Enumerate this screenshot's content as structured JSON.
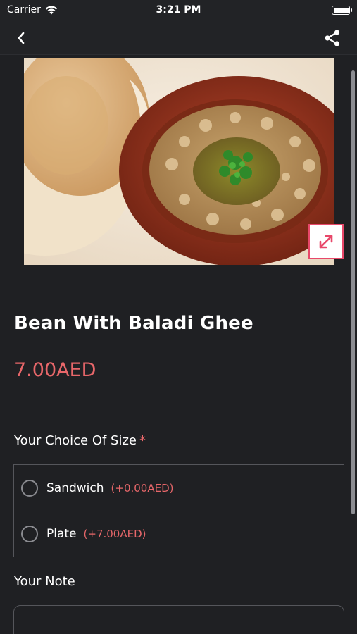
{
  "status_bar": {
    "carrier": "Carrier",
    "time": "3:21 PM",
    "icons": [
      "wifi-icon",
      "battery-icon"
    ]
  },
  "nav": {
    "back_icon": "chevron-left-icon",
    "share_icon": "share-icon"
  },
  "product": {
    "title": "Bean With Baladi Ghee",
    "price": "7.00AED",
    "image_icon_expand": "expand-icon"
  },
  "size_section": {
    "label": "Your Choice Of Size",
    "required_mark": "*",
    "options": [
      {
        "label": "Sandwich",
        "price": "(+0.00AED)"
      },
      {
        "label": "Plate",
        "price": "(+7.00AED)"
      }
    ]
  },
  "note_section": {
    "label": "Your Note",
    "value": ""
  },
  "colors": {
    "accent": "#e8676a",
    "expand_border": "#e8486a",
    "background": "#1f2023"
  }
}
